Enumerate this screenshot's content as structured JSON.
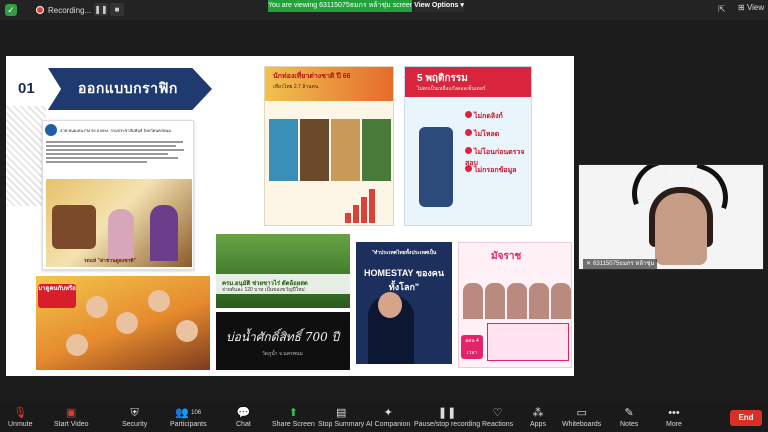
{
  "topbar": {
    "recording_label": "Recording...",
    "viewing_banner": "You are viewing 63115075ธมกร หล้าชุ่ม screen",
    "view_options": "View Options",
    "view_label": "View"
  },
  "slide": {
    "section_number": "01",
    "section_title": "ออกแบบกราฟิก",
    "fb_name": "สวท.พนมเทน FM 99.5 MHz. กรมประชาสัมพันธ์ จังหวัดนครพนม",
    "fb_caption": "รถแห่ \"ล่าชวนดูธงชาติ\"",
    "promo1_tag": "มาดูคนกับหรือ",
    "trip_title": "นักท่องเที่ยวต่างชาติ ปี 66",
    "trip_sub": "เที่ยวไทย 2.7 ล้านคน",
    "fraud_title": "5 พฤติกรรม",
    "fraud_sub": "ไม่ตกเป็นเหยื่อแก๊งคอลเซ็นเตอร์",
    "fraud_items": [
      "ไม่กดลิงก์",
      "ไม่โหลด",
      "ไม่โอนก่อนตรวจสอบ",
      "ไม่กรอกข้อมูล"
    ],
    "sugar_text": "ครม.อนุมัติ ช่วยชาวไร่ ตัดอ้อยสด",
    "sugar_text2": "จ่ายตันละ 120 บาท เป็นของขวัญปีใหม่",
    "temple_title": "บ่อน้ำศักดิ์สิทธิ์ 700 ปี",
    "temple_sub": "วัดภูน้ำ จ.นครพนม",
    "homestay_quote": "\"ทำประเทศไทยทั้งประเทศเป็น",
    "homestay_title": "HOMESTAY ของคนทั้งโลก\"",
    "event_title": "มัจราช",
    "event_badge": "อ่อน 4 เวลา"
  },
  "video": {
    "participant_name": "63115075ธมกร หล้าชุ่ม"
  },
  "toolbar": {
    "items": [
      {
        "label": "Unmute",
        "icon": "microphone-muted-icon"
      },
      {
        "label": "Start Video",
        "icon": "video-off-icon"
      },
      {
        "label": "Security",
        "icon": "shield-icon"
      },
      {
        "label": "Participants",
        "icon": "participants-icon",
        "count": "106"
      },
      {
        "label": "Chat",
        "icon": "chat-icon"
      },
      {
        "label": "Share Screen",
        "icon": "share-screen-icon"
      },
      {
        "label": "Stop Summary",
        "icon": "summary-icon"
      },
      {
        "label": "AI Companion",
        "icon": "ai-sparkle-icon"
      },
      {
        "label": "Pause/stop recording",
        "icon": "recording-icon"
      },
      {
        "label": "Reactions",
        "icon": "reactions-icon"
      },
      {
        "label": "Apps",
        "icon": "apps-icon"
      },
      {
        "label": "Whiteboards",
        "icon": "whiteboard-icon"
      },
      {
        "label": "Notes",
        "icon": "notes-icon"
      },
      {
        "label": "More",
        "icon": "more-icon"
      }
    ],
    "end_label": "End"
  },
  "colors": {
    "banner_green": "#22a33a",
    "end_red": "#d93025",
    "title_navy": "#1f3a6e"
  }
}
